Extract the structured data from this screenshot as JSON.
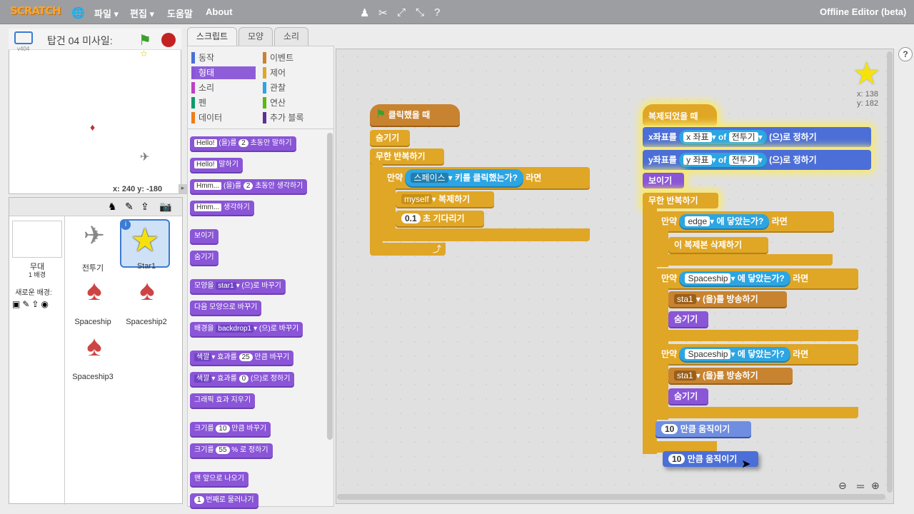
{
  "app": {
    "logo": "SCRATCH",
    "title": "Offline Editor (beta)"
  },
  "menu": {
    "file": "파일 ▾",
    "edit": "편집 ▾",
    "help": "도움말",
    "about": "About"
  },
  "stage": {
    "project_name": "탑건 04 미사일:",
    "version": "v404",
    "coords": "x: 240  y: -180"
  },
  "tabs": {
    "scripts": "스크립트",
    "costumes": "모양",
    "sounds": "소리"
  },
  "categories": [
    {
      "label": "동작",
      "color": "#4c6fd7"
    },
    {
      "label": "이벤트",
      "color": "#c88330"
    },
    {
      "label": "형태",
      "color": "#8a55d7"
    },
    {
      "label": "제어",
      "color": "#e0a626"
    },
    {
      "label": "소리",
      "color": "#bb42c3"
    },
    {
      "label": "관찰",
      "color": "#2ca5e2"
    },
    {
      "label": "펜",
      "color": "#0e9a6c"
    },
    {
      "label": "연산",
      "color": "#5cb712"
    },
    {
      "label": "데이터",
      "color": "#ee7d16"
    },
    {
      "label": "추가 블록",
      "color": "#632d99"
    }
  ],
  "palette": {
    "say_secs": {
      "a": "Hello!",
      "b": "(을)를",
      "c": "2",
      "d": "초동안 말하기"
    },
    "say": {
      "a": "Hello!",
      "b": "말하기"
    },
    "think_secs": {
      "a": "Hmm...",
      "b": "(을)를",
      "c": "2",
      "d": "초동안 생각하기"
    },
    "think": {
      "a": "Hmm...",
      "b": "생각하기"
    },
    "show": "보이기",
    "hide": "숨기기",
    "switch_costume": {
      "a": "모양을",
      "b": "star1",
      "c": "(으)로 바꾸기"
    },
    "next_costume": "다음 모양으로 바꾸기",
    "switch_backdrop": {
      "a": "배경을",
      "b": "backdrop1",
      "c": "(으)로 바꾸기"
    },
    "change_effect": {
      "a": "색깔",
      "b": "효과를",
      "c": "25",
      "d": "만큼 바꾸기"
    },
    "set_effect": {
      "a": "색깔",
      "b": "효과를",
      "c": "0",
      "d": "(으)로 정하기"
    },
    "clear_effects": "그래픽 효과 지우기",
    "change_size": {
      "a": "크기를",
      "b": "10",
      "c": "만큼 바꾸기"
    },
    "set_size": {
      "a": "크기를",
      "b": "55",
      "c": "% 로 정하기"
    },
    "front": "맨 앞으로 나오기",
    "back": {
      "a": "1",
      "b": "번째로 물러나기"
    }
  },
  "script1": {
    "hat": "클릭했을 때",
    "hide": "숨기기",
    "forever": "무한 반복하기",
    "if": "만약",
    "key": "스페이스",
    "key_q": "키를 클릭했는가?",
    "then": "라면",
    "clone": "myself",
    "clone_t": "복제하기",
    "wait_n": "0.1",
    "wait_t": "초 기다리기"
  },
  "script2": {
    "hat": "복제되었을 때",
    "setx": "x좌표를",
    "x_attr": "x 좌표",
    "of": "of",
    "obj": "전투기",
    "set_t": "(으)로 정하기",
    "sety": "y좌표를",
    "y_attr": "y 좌표",
    "show": "보이기",
    "forever": "무한 반복하기",
    "if": "만약",
    "edge": "edge",
    "touch": "에 닿았는가?",
    "then": "라면",
    "del_clone": "이 복제본 삭제하기",
    "ship": "Spaceship",
    "msg": "sta1",
    "bcast": "(을)를 방송하기",
    "hide": "숨기기",
    "move_n": "10",
    "move_t": "만큼 움직이기"
  },
  "star_info": {
    "x": "x: 138",
    "y": "y: 182"
  },
  "sprites": {
    "stage_label": "무대",
    "backdrops": "1 배경",
    "new_backdrop": "새로운 배경:",
    "items": [
      "전투기",
      "Star1",
      "Spaceship",
      "Spaceship2",
      "Spaceship3"
    ]
  }
}
